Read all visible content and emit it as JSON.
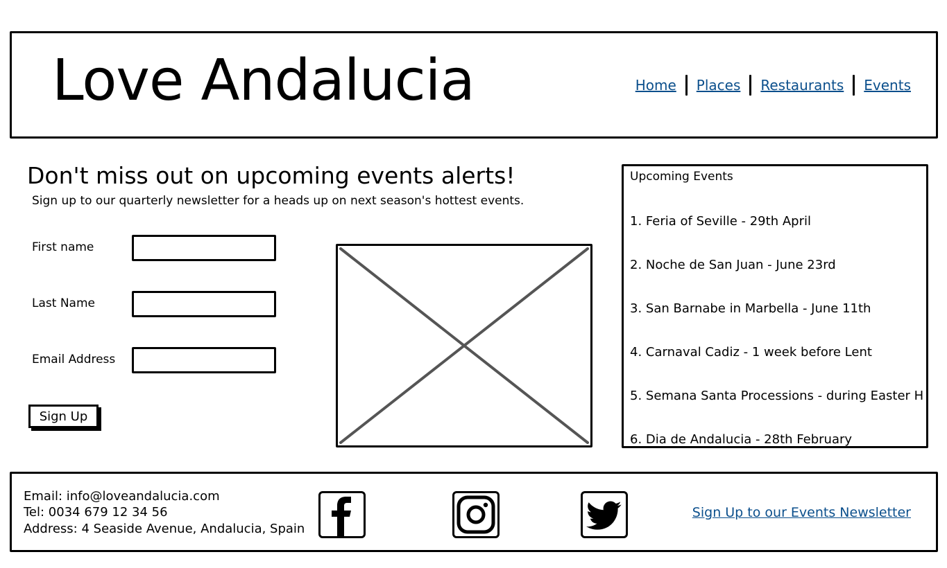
{
  "header": {
    "site_title": "Love Andalucia",
    "nav": [
      {
        "label": "Home"
      },
      {
        "label": "Places"
      },
      {
        "label": "Restaurants"
      },
      {
        "label": "Events"
      }
    ]
  },
  "main": {
    "heading": "Don't miss out on upcoming events alerts!",
    "subheading": "Sign up to our quarterly newsletter for a heads up on next season's hottest events.",
    "form": {
      "first_name_label": "First name",
      "first_name_value": "",
      "last_name_label": "Last Name",
      "last_name_value": "",
      "email_label": "Email Address",
      "email_value": "",
      "submit_label": "Sign Up"
    }
  },
  "events_panel": {
    "title": "Upcoming Events",
    "items": [
      "1. Feria of Seville - 29th April",
      "2. Noche de San Juan - June 23rd",
      "3. San Barnabe in Marbella - June 11th",
      "4. Carnaval  Cadiz - 1 week before Lent",
      "5. Semana Santa Processions - during Easter H",
      "6. Dia de Andalucia - 28th February"
    ]
  },
  "footer": {
    "email": "Email: info@loveandalucia.com",
    "tel": "Tel: 0034 679 12 34 56",
    "address": "Address: 4 Seaside Avenue, Andalucia, Spain",
    "newsletter_link": "Sign Up to our Events Newsletter",
    "social_icons": [
      "facebook-icon",
      "instagram-icon",
      "twitter-icon"
    ]
  },
  "colors": {
    "link": "#0b4f8c",
    "border": "#000000",
    "placeholder_cross": "#555555"
  }
}
